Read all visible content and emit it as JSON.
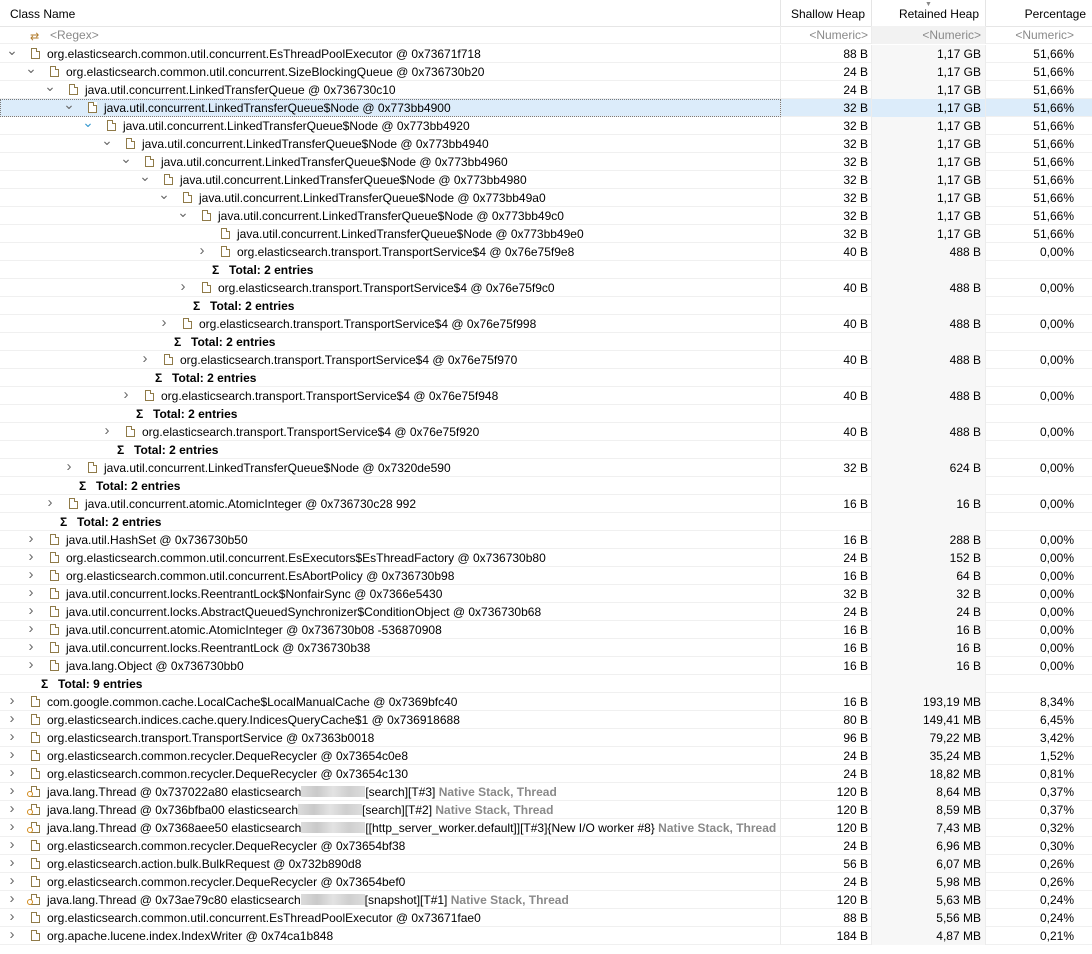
{
  "header": {
    "class_name": "Class Name",
    "shallow_heap": "Shallow Heap",
    "retained_heap": "Retained Heap",
    "percentage": "Percentage"
  },
  "filter": {
    "name": "<Regex>",
    "shallow": "<Numeric>",
    "retained": "<Numeric>",
    "pct": "<Numeric>"
  },
  "rows": [
    {
      "level": 0,
      "kind": "node",
      "exp": "open",
      "name": "org.elasticsearch.common.util.concurrent.EsThreadPoolExecutor @ 0x73671f718",
      "shallow": "88 B",
      "retained": "1,17 GB",
      "pct": "51,66%"
    },
    {
      "level": 1,
      "kind": "node",
      "exp": "open",
      "name": "org.elasticsearch.common.util.concurrent.SizeBlockingQueue @ 0x736730b20",
      "shallow": "24 B",
      "retained": "1,17 GB",
      "pct": "51,66%"
    },
    {
      "level": 2,
      "kind": "node",
      "exp": "open",
      "name": "java.util.concurrent.LinkedTransferQueue @ 0x736730c10",
      "shallow": "24 B",
      "retained": "1,17 GB",
      "pct": "51,66%"
    },
    {
      "level": 3,
      "kind": "node",
      "exp": "open",
      "sel": true,
      "name": "java.util.concurrent.LinkedTransferQueue$Node @ 0x773bb4900",
      "shallow": "32 B",
      "retained": "1,17 GB",
      "pct": "51,66%"
    },
    {
      "level": 4,
      "kind": "node",
      "exp": "open-alt",
      "name": "java.util.concurrent.LinkedTransferQueue$Node @ 0x773bb4920",
      "shallow": "32 B",
      "retained": "1,17 GB",
      "pct": "51,66%"
    },
    {
      "level": 5,
      "kind": "node",
      "exp": "open",
      "name": "java.util.concurrent.LinkedTransferQueue$Node @ 0x773bb4940",
      "shallow": "32 B",
      "retained": "1,17 GB",
      "pct": "51,66%"
    },
    {
      "level": 6,
      "kind": "node",
      "exp": "open",
      "name": "java.util.concurrent.LinkedTransferQueue$Node @ 0x773bb4960",
      "shallow": "32 B",
      "retained": "1,17 GB",
      "pct": "51,66%"
    },
    {
      "level": 7,
      "kind": "node",
      "exp": "open",
      "name": "java.util.concurrent.LinkedTransferQueue$Node @ 0x773bb4980",
      "shallow": "32 B",
      "retained": "1,17 GB",
      "pct": "51,66%"
    },
    {
      "level": 8,
      "kind": "node",
      "exp": "open",
      "name": "java.util.concurrent.LinkedTransferQueue$Node @ 0x773bb49a0",
      "shallow": "32 B",
      "retained": "1,17 GB",
      "pct": "51,66%"
    },
    {
      "level": 9,
      "kind": "node",
      "exp": "open",
      "name": "java.util.concurrent.LinkedTransferQueue$Node @ 0x773bb49c0",
      "shallow": "32 B",
      "retained": "1,17 GB",
      "pct": "51,66%"
    },
    {
      "level": 10,
      "kind": "node",
      "exp": "none",
      "name": "java.util.concurrent.LinkedTransferQueue$Node @ 0x773bb49e0",
      "shallow": "32 B",
      "retained": "1,17 GB",
      "pct": "51,66%"
    },
    {
      "level": 10,
      "kind": "node",
      "exp": "closed",
      "name": "org.elasticsearch.transport.TransportService$4 @ 0x76e75f9e8",
      "shallow": "40 B",
      "retained": "488 B",
      "pct": "0,00%"
    },
    {
      "level": 10,
      "kind": "total",
      "name": "Total: 2 entries"
    },
    {
      "level": 9,
      "kind": "node",
      "exp": "closed",
      "name": "org.elasticsearch.transport.TransportService$4 @ 0x76e75f9c0",
      "shallow": "40 B",
      "retained": "488 B",
      "pct": "0,00%"
    },
    {
      "level": 9,
      "kind": "total",
      "name": "Total: 2 entries"
    },
    {
      "level": 8,
      "kind": "node",
      "exp": "closed",
      "name": "org.elasticsearch.transport.TransportService$4 @ 0x76e75f998",
      "shallow": "40 B",
      "retained": "488 B",
      "pct": "0,00%"
    },
    {
      "level": 8,
      "kind": "total",
      "name": "Total: 2 entries"
    },
    {
      "level": 7,
      "kind": "node",
      "exp": "closed",
      "name": "org.elasticsearch.transport.TransportService$4 @ 0x76e75f970",
      "shallow": "40 B",
      "retained": "488 B",
      "pct": "0,00%"
    },
    {
      "level": 7,
      "kind": "total",
      "name": "Total: 2 entries"
    },
    {
      "level": 6,
      "kind": "node",
      "exp": "closed",
      "name": "org.elasticsearch.transport.TransportService$4 @ 0x76e75f948",
      "shallow": "40 B",
      "retained": "488 B",
      "pct": "0,00%"
    },
    {
      "level": 6,
      "kind": "total",
      "name": "Total: 2 entries"
    },
    {
      "level": 5,
      "kind": "node",
      "exp": "closed",
      "name": "org.elasticsearch.transport.TransportService$4 @ 0x76e75f920",
      "shallow": "40 B",
      "retained": "488 B",
      "pct": "0,00%"
    },
    {
      "level": 5,
      "kind": "total",
      "name": "Total: 2 entries"
    },
    {
      "level": 3,
      "kind": "node",
      "exp": "closed",
      "name": "java.util.concurrent.LinkedTransferQueue$Node @ 0x7320de590",
      "shallow": "32 B",
      "retained": "624 B",
      "pct": "0,00%"
    },
    {
      "level": 3,
      "kind": "total",
      "name": "Total: 2 entries"
    },
    {
      "level": 2,
      "kind": "node",
      "exp": "closed",
      "name": "java.util.concurrent.atomic.AtomicInteger @ 0x736730c28  992",
      "shallow": "16 B",
      "retained": "16 B",
      "pct": "0,00%"
    },
    {
      "level": 2,
      "kind": "total",
      "name": "Total: 2 entries"
    },
    {
      "level": 1,
      "kind": "node",
      "exp": "closed",
      "name": "java.util.HashSet @ 0x736730b50",
      "shallow": "16 B",
      "retained": "288 B",
      "pct": "0,00%"
    },
    {
      "level": 1,
      "kind": "node",
      "exp": "closed",
      "name": "org.elasticsearch.common.util.concurrent.EsExecutors$EsThreadFactory @ 0x736730b80",
      "shallow": "24 B",
      "retained": "152 B",
      "pct": "0,00%"
    },
    {
      "level": 1,
      "kind": "node",
      "exp": "closed",
      "name": "org.elasticsearch.common.util.concurrent.EsAbortPolicy @ 0x736730b98",
      "shallow": "16 B",
      "retained": "64 B",
      "pct": "0,00%"
    },
    {
      "level": 1,
      "kind": "node",
      "exp": "closed",
      "name": "java.util.concurrent.locks.ReentrantLock$NonfairSync @ 0x7366e5430",
      "shallow": "32 B",
      "retained": "32 B",
      "pct": "0,00%"
    },
    {
      "level": 1,
      "kind": "node",
      "exp": "closed",
      "name": "java.util.concurrent.locks.AbstractQueuedSynchronizer$ConditionObject @ 0x736730b68",
      "shallow": "24 B",
      "retained": "24 B",
      "pct": "0,00%"
    },
    {
      "level": 1,
      "kind": "node",
      "exp": "closed",
      "name": "java.util.concurrent.atomic.AtomicInteger @ 0x736730b08  -536870908",
      "shallow": "16 B",
      "retained": "16 B",
      "pct": "0,00%"
    },
    {
      "level": 1,
      "kind": "node",
      "exp": "closed",
      "name": "java.util.concurrent.locks.ReentrantLock @ 0x736730b38",
      "shallow": "16 B",
      "retained": "16 B",
      "pct": "0,00%"
    },
    {
      "level": 1,
      "kind": "node",
      "exp": "closed",
      "name": "java.lang.Object @ 0x736730bb0",
      "shallow": "16 B",
      "retained": "16 B",
      "pct": "0,00%"
    },
    {
      "level": 1,
      "kind": "total",
      "name": "Total: 9 entries"
    },
    {
      "level": 0,
      "kind": "node",
      "exp": "closed",
      "name": "com.google.common.cache.LocalCache$LocalManualCache @ 0x7369bfc40",
      "shallow": "16 B",
      "retained": "193,19 MB",
      "pct": "8,34%"
    },
    {
      "level": 0,
      "kind": "node",
      "exp": "closed",
      "name": "org.elasticsearch.indices.cache.query.IndicesQueryCache$1 @ 0x736918688",
      "shallow": "80 B",
      "retained": "149,41 MB",
      "pct": "6,45%"
    },
    {
      "level": 0,
      "kind": "node",
      "exp": "closed",
      "name": "org.elasticsearch.transport.TransportService @ 0x7363b0018",
      "shallow": "96 B",
      "retained": "79,22 MB",
      "pct": "3,42%"
    },
    {
      "level": 0,
      "kind": "node",
      "exp": "closed",
      "name": "org.elasticsearch.common.recycler.DequeRecycler @ 0x73654c0e8",
      "shallow": "24 B",
      "retained": "35,24 MB",
      "pct": "1,52%"
    },
    {
      "level": 0,
      "kind": "node",
      "exp": "closed",
      "name": "org.elasticsearch.common.recycler.DequeRecycler @ 0x73654c130",
      "shallow": "24 B",
      "retained": "18,82 MB",
      "pct": "0,81%"
    },
    {
      "level": 0,
      "kind": "node",
      "exp": "closed",
      "thread": true,
      "name": "java.lang.Thread @ 0x737022a80  elasticsearch",
      "blurred": true,
      "name_suffix": "[search][T#3]",
      "tag": "Native Stack, Thread",
      "shallow": "120 B",
      "retained": "8,64 MB",
      "pct": "0,37%"
    },
    {
      "level": 0,
      "kind": "node",
      "exp": "closed",
      "thread": true,
      "name": "java.lang.Thread @ 0x736bfba00  elasticsearch",
      "blurred": true,
      "name_suffix": "[search][T#2]",
      "tag": "Native Stack, Thread",
      "shallow": "120 B",
      "retained": "8,59 MB",
      "pct": "0,37%"
    },
    {
      "level": 0,
      "kind": "node",
      "exp": "closed",
      "thread": true,
      "name": "java.lang.Thread @ 0x7368aee50  elasticsearch",
      "blurred": true,
      "name_suffix": "[[http_server_worker.default]][T#3]{New I/O worker #8}",
      "tag": "Native Stack, Thread",
      "shallow": "120 B",
      "retained": "7,43 MB",
      "pct": "0,32%"
    },
    {
      "level": 0,
      "kind": "node",
      "exp": "closed",
      "name": "org.elasticsearch.common.recycler.DequeRecycler @ 0x73654bf38",
      "shallow": "24 B",
      "retained": "6,96 MB",
      "pct": "0,30%"
    },
    {
      "level": 0,
      "kind": "node",
      "exp": "closed",
      "name": "org.elasticsearch.action.bulk.BulkRequest @ 0x732b890d8",
      "shallow": "56 B",
      "retained": "6,07 MB",
      "pct": "0,26%"
    },
    {
      "level": 0,
      "kind": "node",
      "exp": "closed",
      "name": "org.elasticsearch.common.recycler.DequeRecycler @ 0x73654bef0",
      "shallow": "24 B",
      "retained": "5,98 MB",
      "pct": "0,26%"
    },
    {
      "level": 0,
      "kind": "node",
      "exp": "closed",
      "thread": true,
      "name": "java.lang.Thread @ 0x73ae79c80  elasticsearch",
      "blurred": true,
      "name_suffix": "[snapshot][T#1]",
      "tag": "Native Stack, Thread",
      "shallow": "120 B",
      "retained": "5,63 MB",
      "pct": "0,24%"
    },
    {
      "level": 0,
      "kind": "node",
      "exp": "closed",
      "name": "org.elasticsearch.common.util.concurrent.EsThreadPoolExecutor @ 0x73671fae0",
      "shallow": "88 B",
      "retained": "5,56 MB",
      "pct": "0,24%"
    },
    {
      "level": 0,
      "kind": "node",
      "exp": "closed",
      "name": "org.apache.lucene.index.IndexWriter @ 0x74ca1b848",
      "shallow": "184 B",
      "retained": "4,87 MB",
      "pct": "0,21%"
    }
  ]
}
